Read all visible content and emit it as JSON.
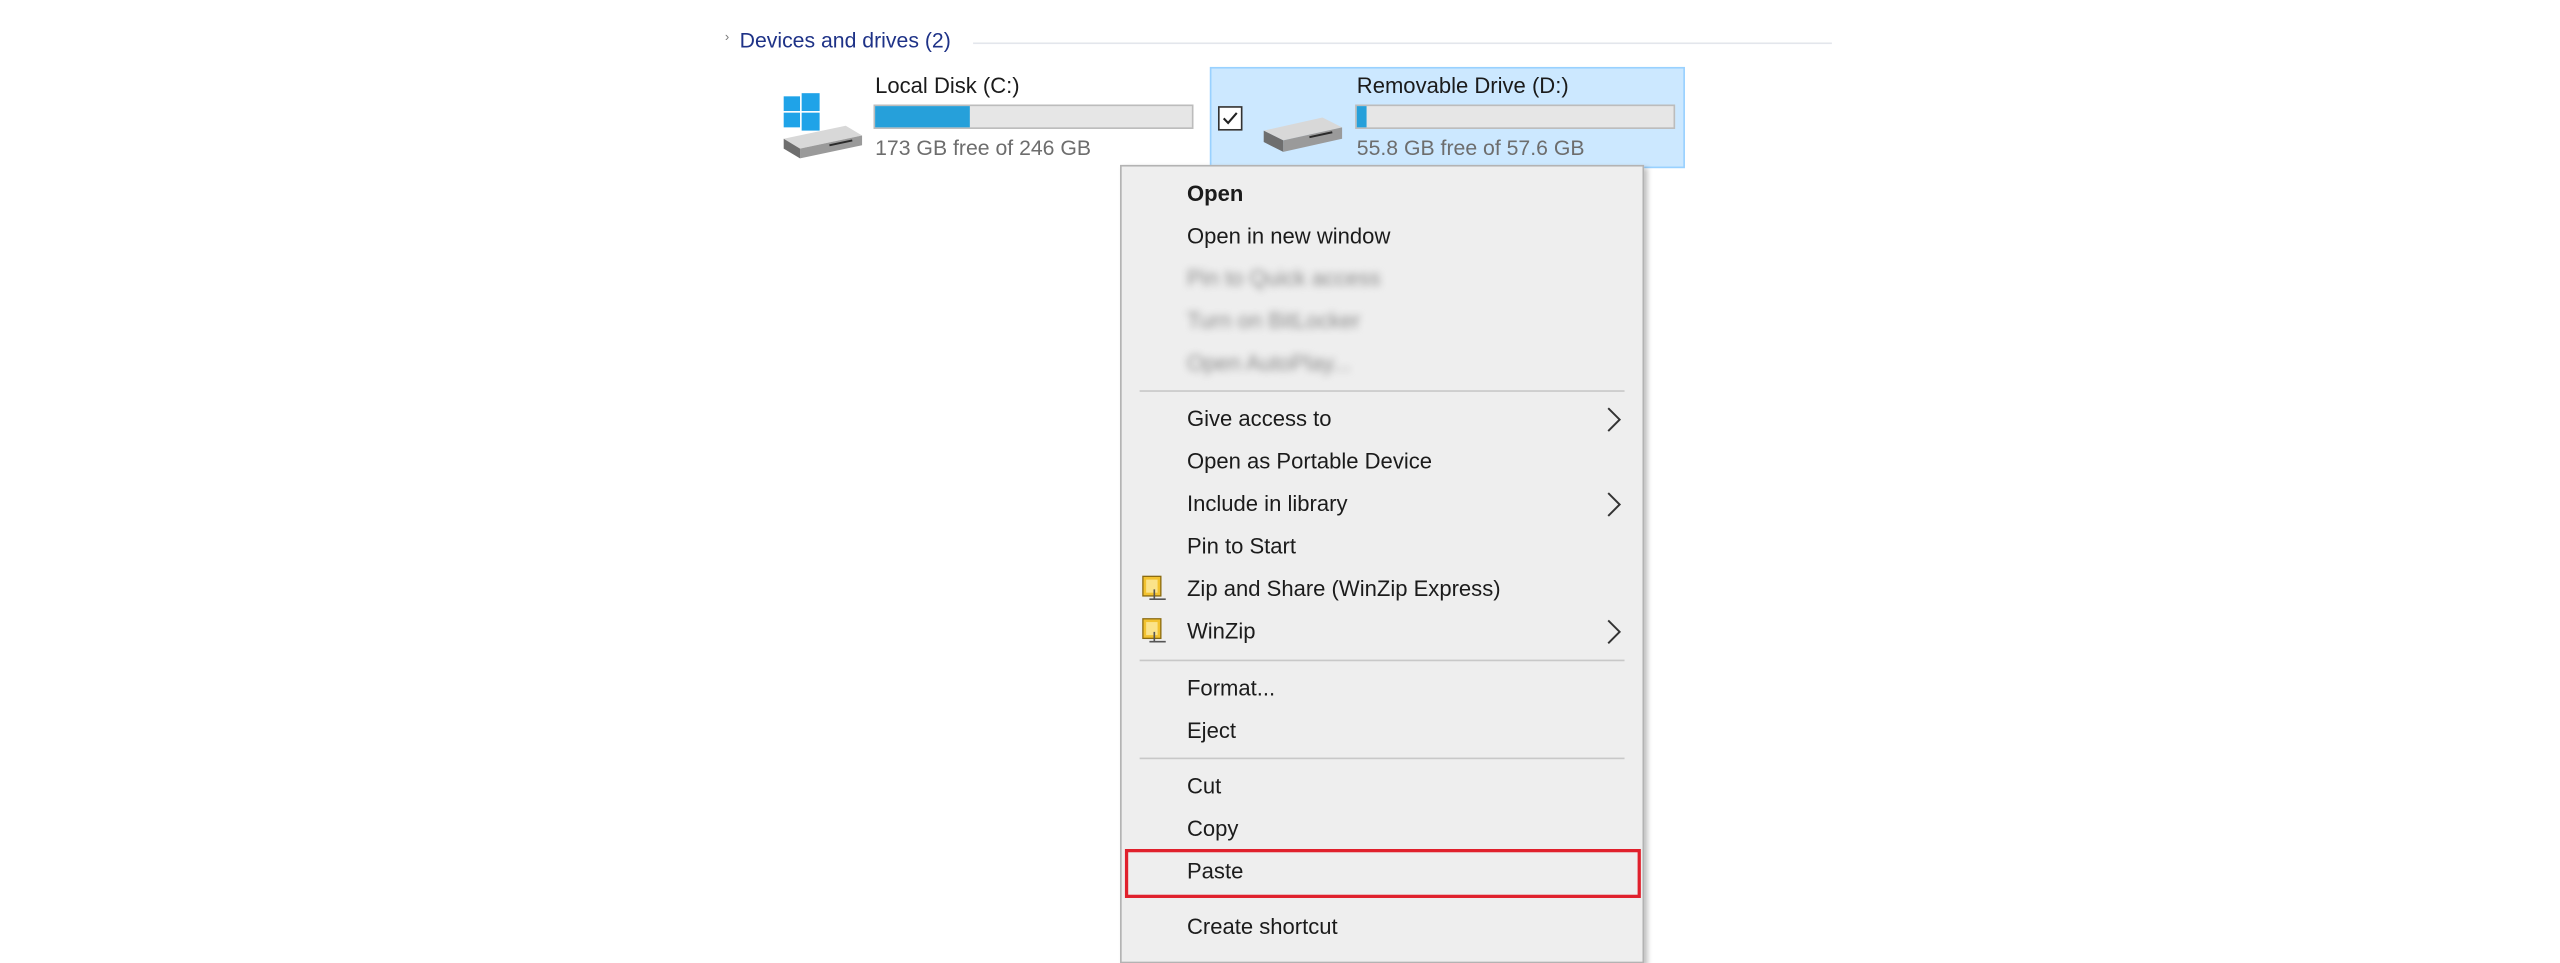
{
  "section": {
    "title": "Devices and drives (2)"
  },
  "drives": [
    {
      "name": "Local Disk (C:)",
      "free_text": "173 GB free of 246 GB",
      "used_fraction": 0.3,
      "icon": "windows-drive-icon",
      "selected": false
    },
    {
      "name": "Removable Drive (D:)",
      "free_text": "55.8 GB free of 57.6 GB",
      "used_fraction": 0.03,
      "icon": "removable-drive-icon",
      "selected": true
    }
  ],
  "context_menu": {
    "group1": {
      "open": "Open",
      "open_new_window": "Open in new window",
      "pin_quick_access": "Pin to Quick access",
      "turn_on_bitlocker": "Turn on BitLocker",
      "open_autoplay": "Open AutoPlay..."
    },
    "group2": {
      "give_access": "Give access to",
      "open_portable": "Open as Portable Device",
      "include_library": "Include in library",
      "pin_start": "Pin to Start",
      "zip_share": "Zip and Share (WinZip Express)",
      "winzip": "WinZip"
    },
    "group3": {
      "format": "Format...",
      "eject": "Eject"
    },
    "group4": {
      "cut": "Cut",
      "copy": "Copy",
      "paste": "Paste",
      "create_shortcut": "Create shortcut"
    },
    "highlight_color": "#e0202c"
  },
  "colors": {
    "selection_bg": "#cce8ff",
    "selection_border": "#99d1ff",
    "bar_fill": "#26a0da",
    "section_title": "#1e3287"
  }
}
